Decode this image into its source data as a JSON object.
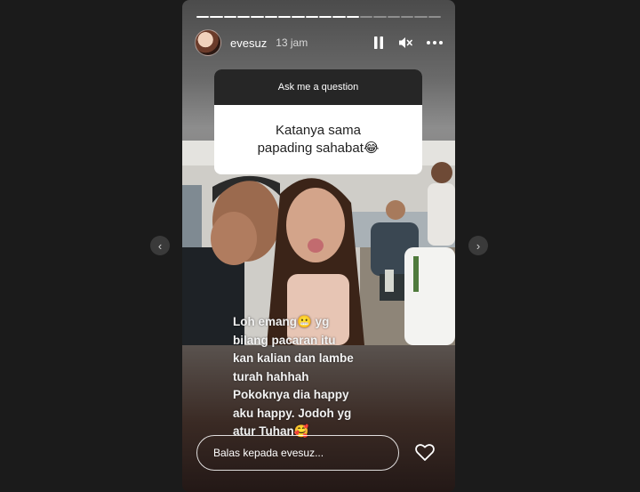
{
  "story": {
    "progress_total": 18,
    "progress_filled": 12,
    "header": {
      "username": "evesuz",
      "timestamp": "13 jam",
      "icons": [
        "pause-icon",
        "mute-icon",
        "more-icon"
      ]
    },
    "sticker": {
      "title": "Ask me a question",
      "question_lines": [
        "Katanya sama",
        "papading sahabat😂"
      ]
    },
    "caption_lines": [
      "Loh emang😬 yg",
      "bilang pacaran itu",
      "kan kalian dan lambe",
      "turah hahhah",
      "Pokoknya dia happy",
      "aku happy. Jodoh yg",
      "atur Tuhan🥰"
    ],
    "reply_placeholder": "Balas kepada evesuz...",
    "like_icon": "heart-icon"
  },
  "nav": {
    "prev_icon": "chevron-left-icon",
    "next_icon": "chevron-right-icon",
    "prev_glyph": "‹",
    "next_glyph": "›"
  }
}
